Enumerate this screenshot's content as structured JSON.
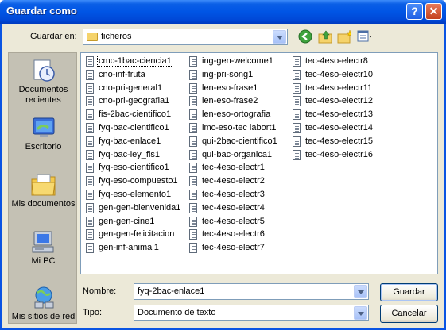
{
  "window": {
    "title": "Guardar como",
    "help_label": "?",
    "close_label": "✕"
  },
  "save_in": {
    "label": "Guardar en:",
    "value": "ficheros"
  },
  "toolbar": {
    "icons": [
      "back-icon",
      "up-folder-icon",
      "new-folder-icon",
      "view-menu-icon"
    ]
  },
  "places": [
    {
      "label": "Documentos recientes",
      "icon": "recent-documents-icon"
    },
    {
      "label": "Escritorio",
      "icon": "desktop-icon"
    },
    {
      "label": "Mis documentos",
      "icon": "my-documents-icon"
    },
    {
      "label": "Mi PC",
      "icon": "my-computer-icon"
    },
    {
      "label": "Mis sitios de red",
      "icon": "network-places-icon"
    }
  ],
  "files": [
    "cmc-1bac-ciencia1",
    "cno-inf-fruta",
    "cno-pri-general1",
    "cno-pri-geografia1",
    "fis-2bac-cientifico1",
    "fyq-bac-cientifico1",
    "fyq-bac-enlace1",
    "fyq-bac-ley_fis1",
    "fyq-eso-cientifico1",
    "fyq-eso-compuesto1",
    "fyq-eso-elemento1",
    "gen-gen-bienvenida1",
    "gen-gen-cine1",
    "gen-gen-felicitacion",
    "gen-inf-animal1",
    "ing-gen-welcome1",
    "ing-pri-song1",
    "len-eso-frase1",
    "len-eso-frase2",
    "len-eso-ortografia",
    "lmc-eso-tec labort1",
    "qui-2bac-cientifico1",
    "qui-bac-organica1",
    "tec-4eso-electr1",
    "tec-4eso-electr2",
    "tec-4eso-electr3",
    "tec-4eso-electr4",
    "tec-4eso-electr5",
    "tec-4eso-electr6",
    "tec-4eso-electr7",
    "tec-4eso-electr8",
    "tec-4eso-electr10",
    "tec-4eso-electr11",
    "tec-4eso-electr12",
    "tec-4eso-electr13",
    "tec-4eso-electr14",
    "tec-4eso-electr15",
    "tec-4eso-electr16"
  ],
  "selected_file": "cmc-1bac-ciencia1",
  "filename": {
    "label": "Nombre:",
    "value": "fyq-2bac-enlace1"
  },
  "filetype": {
    "label": "Tipo:",
    "value": "Documento de texto"
  },
  "buttons": {
    "save": "Guardar",
    "cancel": "Cancelar"
  },
  "colors": {
    "titlebar": "#0055e5",
    "client": "#ece9d8",
    "places_bar": "#c4c1b4"
  }
}
